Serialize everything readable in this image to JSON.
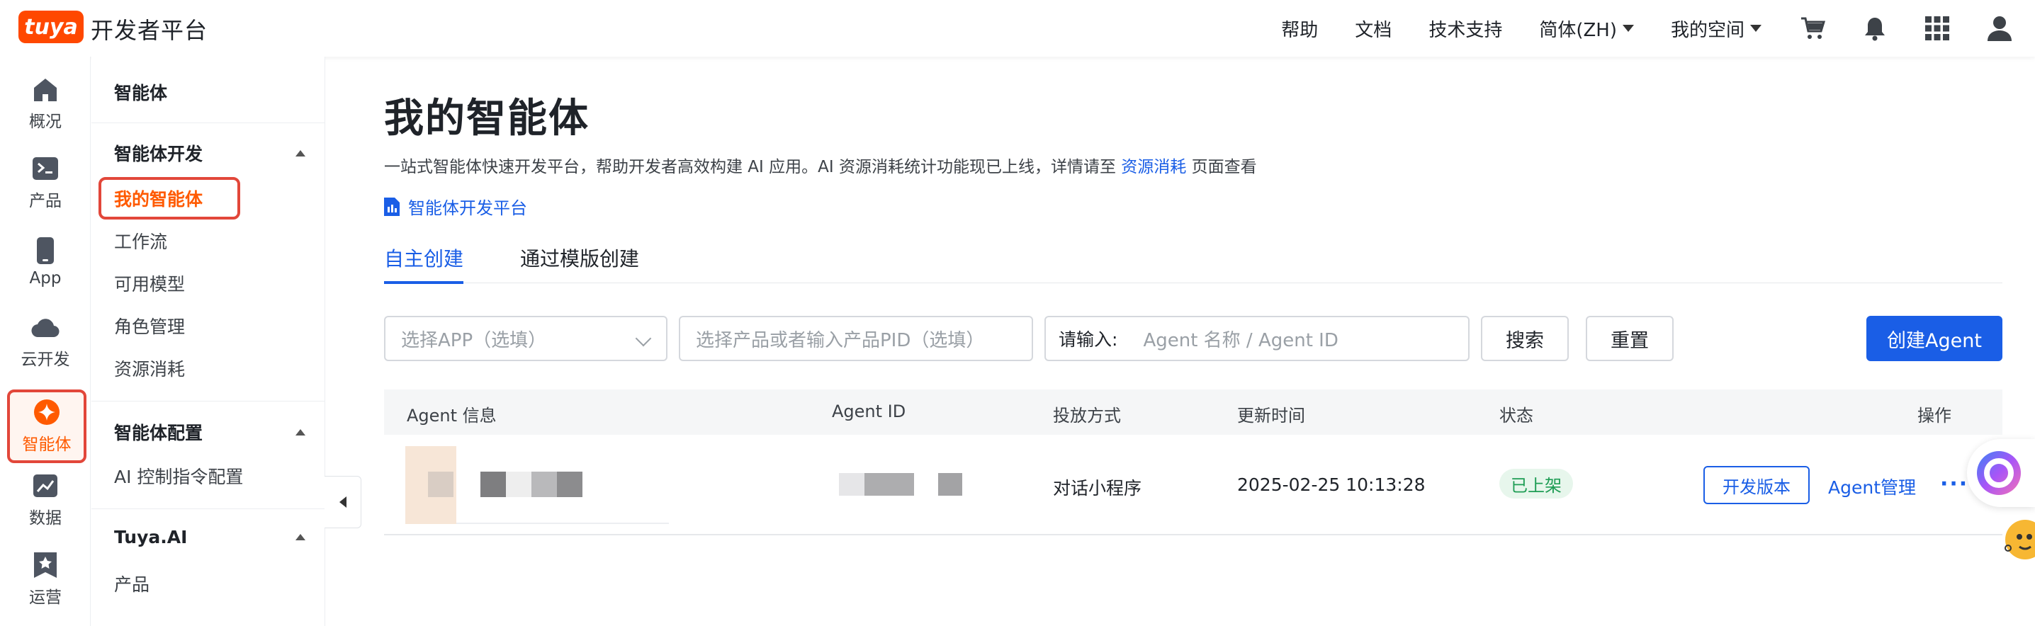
{
  "brand": {
    "logo_text": "tuya",
    "title": "开发者平台"
  },
  "header": {
    "nav": [
      "帮助",
      "文档",
      "技术支持",
      "简体(ZH)",
      "我的空间"
    ],
    "icons": [
      "cart-icon",
      "bell-icon",
      "apps-grid-icon",
      "user-icon"
    ]
  },
  "rail": {
    "items": [
      {
        "label": "概况",
        "icon": "home-icon"
      },
      {
        "label": "产品",
        "icon": "terminal-icon"
      },
      {
        "label": "App",
        "icon": "phone-icon"
      },
      {
        "label": "云开发",
        "icon": "cloud-icon"
      },
      {
        "label": "智能体",
        "icon": "sparkle-icon",
        "active": true
      },
      {
        "label": "数据",
        "icon": "chart-icon"
      },
      {
        "label": "运营",
        "icon": "bookmark-star-icon"
      }
    ]
  },
  "submenu": {
    "title": "智能体",
    "group1": {
      "label": "智能体开发",
      "items": [
        "我的智能体",
        "工作流",
        "可用模型",
        "角色管理",
        "资源消耗"
      ]
    },
    "group2": {
      "label": "智能体配置",
      "items": [
        "AI 控制指令配置"
      ]
    },
    "group3": {
      "label": "Tuya.AI",
      "items": [
        "产品"
      ]
    }
  },
  "main": {
    "title": "我的智能体",
    "desc_prefix": "一站式智能体快速开发平台，帮助开发者高效构建 AI 应用。AI 资源消耗统计功能现已上线，详情请至 ",
    "desc_link": "资源消耗",
    "desc_suffix": " 页面查看",
    "platform_link": "智能体开发平台",
    "tabs": [
      "自主创建",
      "通过模版创建"
    ],
    "filters": {
      "app_placeholder": "选择APP（选填）",
      "product_placeholder": "选择产品或者输入产品PID（选填）",
      "search_label": "请输入:",
      "search_placeholder": "Agent 名称 / Agent ID",
      "search_button": "搜索",
      "reset_button": "重置",
      "create_button": "创建Agent"
    },
    "table": {
      "columns": [
        "Agent 信息",
        "Agent ID",
        "投放方式",
        "更新时间",
        "状态",
        "操作"
      ],
      "rows": [
        {
          "channel": "对话小程序",
          "updated": "2025-02-25 10:13:28",
          "status": "已上架",
          "action_dev": "开发版本",
          "action_manage": "Agent管理",
          "action_more": "···"
        }
      ]
    }
  },
  "colors": {
    "accent": "#1a5ee6",
    "brand": "#ff4800",
    "highlight": "#e2473a",
    "success": "#1f9d55"
  }
}
